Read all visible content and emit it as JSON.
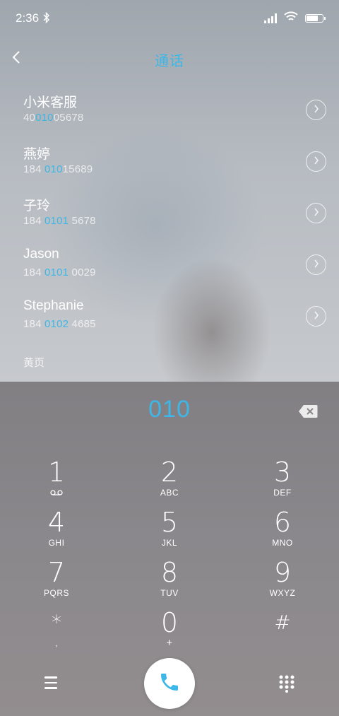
{
  "status_bar": {
    "time": "2:36"
  },
  "header": {
    "title": "通话"
  },
  "results": [
    {
      "name": "小米客服",
      "number_pre": "40",
      "number_match": "010",
      "number_post": "05678"
    },
    {
      "name": "燕婷",
      "number_pre": "184 ",
      "number_match": "010",
      "number_post": "15689"
    },
    {
      "name": "子玲",
      "number_pre": "184 ",
      "number_match": "0101",
      "number_post": " 5678"
    },
    {
      "name": "Jason",
      "number_pre": "184 ",
      "number_match": "0101",
      "number_post": " 0029"
    },
    {
      "name": "Stephanie",
      "number_pre": "184 ",
      "number_match": "0102",
      "number_post": " 4685"
    }
  ],
  "yellow_pages_label": "黄页",
  "dial": {
    "input": "010"
  },
  "keypad": [
    {
      "digit": "1",
      "letters": ""
    },
    {
      "digit": "2",
      "letters": "ABC"
    },
    {
      "digit": "3",
      "letters": "DEF"
    },
    {
      "digit": "4",
      "letters": "GHI"
    },
    {
      "digit": "5",
      "letters": "JKL"
    },
    {
      "digit": "6",
      "letters": "MNO"
    },
    {
      "digit": "7",
      "letters": "PQRS"
    },
    {
      "digit": "8",
      "letters": "TUV"
    },
    {
      "digit": "9",
      "letters": "WXYZ"
    },
    {
      "digit": "*",
      "letters": ","
    },
    {
      "digit": "0",
      "letters": "+"
    },
    {
      "digit": "#",
      "letters": ""
    }
  ],
  "colors": {
    "accent": "#3db7e7",
    "text": "#ffffff"
  },
  "icons": [
    "back-icon",
    "bluetooth-icon",
    "signal-icon",
    "wifi-icon",
    "battery-icon",
    "chevron-right-icon",
    "backspace-icon",
    "voicemail-icon",
    "menu-icon",
    "phone-icon",
    "dialpad-icon"
  ]
}
